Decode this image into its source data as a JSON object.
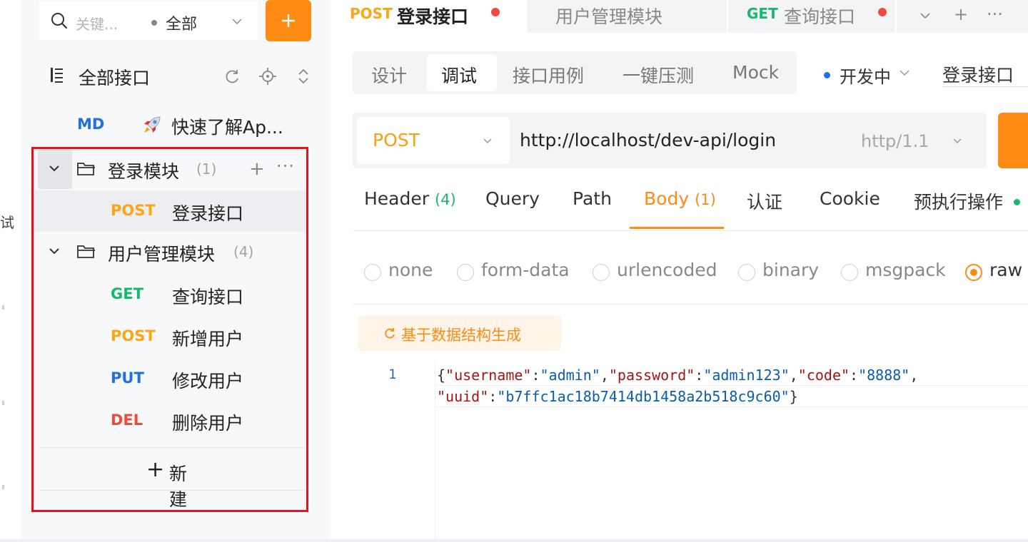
{
  "left_edge": {
    "cut_text": "试"
  },
  "sidebar": {
    "search_placeholder": "关键...",
    "scope_label": "全部",
    "add_label": "+",
    "all_apis_label": "全部接口",
    "md_badge": "MD",
    "md_label": "快速了解Ap...",
    "folders": [
      {
        "name": "登录模块",
        "count": "(1)",
        "apis": [
          {
            "method": "POST",
            "name": "登录接口"
          }
        ]
      },
      {
        "name": "用户管理模块",
        "count": "(4)",
        "apis": [
          {
            "method": "GET",
            "name": "查询接口"
          },
          {
            "method": "POST",
            "name": "新增用户"
          },
          {
            "method": "PUT",
            "name": "修改用户"
          },
          {
            "method": "DEL",
            "name": "删除用户"
          }
        ]
      }
    ],
    "folder_add": "+",
    "folder_more": "···",
    "new_label": "新建"
  },
  "tabs": [
    {
      "method": "POST",
      "name": "登录接口"
    },
    {
      "name": "用户管理模块"
    },
    {
      "method": "GET",
      "name": "查询接口"
    }
  ],
  "tab_controls": {
    "dropdown": "⌄",
    "add": "+",
    "more": "···"
  },
  "mode_tabs": [
    "设计",
    "调试",
    "接口用例",
    "一键压测",
    "Mock"
  ],
  "status": {
    "label": "开发中"
  },
  "api_name_field": "登录接口",
  "request": {
    "method": "POST",
    "url": "http://localhost/dev-api/login",
    "protocol": "http/1.1"
  },
  "request_tabs": [
    {
      "label": "Header",
      "count": "(4)"
    },
    {
      "label": "Query"
    },
    {
      "label": "Path"
    },
    {
      "label": "Body",
      "count": "(1)"
    },
    {
      "label": "认证"
    },
    {
      "label": "Cookie"
    },
    {
      "label": "预执行操作"
    }
  ],
  "body_types": [
    "none",
    "form-data",
    "urlencoded",
    "binary",
    "msgpack",
    "raw"
  ],
  "body_selected": "raw",
  "generate_label": "基于数据结构生成",
  "code": {
    "line_number": "1",
    "k_username": "\"username\"",
    "v_username": "\"admin\"",
    "k_password": "\"password\"",
    "v_password": "\"admin123\"",
    "k_code": "\"code\"",
    "v_code": "\"8888\"",
    "k_uuid": "\"uuid\"",
    "v_uuid": "\"b7ffc1ac18b7414db1458a2b518c9c60\""
  },
  "colors": {
    "accent": "#ff8a14",
    "post": "#ffa414",
    "get": "#17b96e",
    "put": "#1f6fe5",
    "del": "#ef4a3c",
    "highlight_border": "#e1121c"
  }
}
